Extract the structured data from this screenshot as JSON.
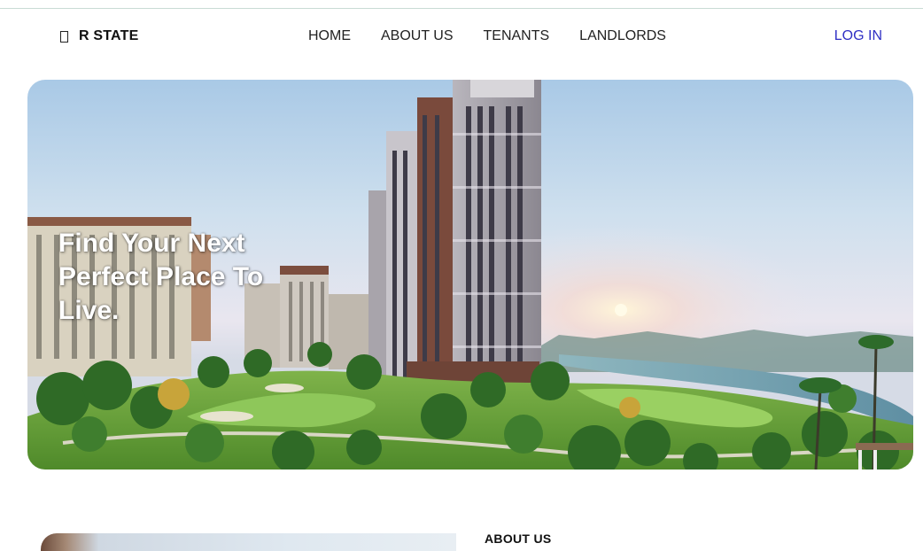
{
  "brand": {
    "name": "R STATE",
    "icon": "building-icon"
  },
  "nav": {
    "items": [
      {
        "label": "HOME"
      },
      {
        "label": "ABOUT US"
      },
      {
        "label": "TENANTS"
      },
      {
        "label": "LANDLORDS"
      }
    ],
    "login_label": "LOG IN"
  },
  "hero": {
    "title": "Find Your Next Perfect Place To Live.",
    "image": "apartment-towers-landscape"
  },
  "about": {
    "heading": "ABOUT US"
  },
  "colors": {
    "login_link": "#2f2fc4",
    "hero_title": "#ffffff"
  }
}
